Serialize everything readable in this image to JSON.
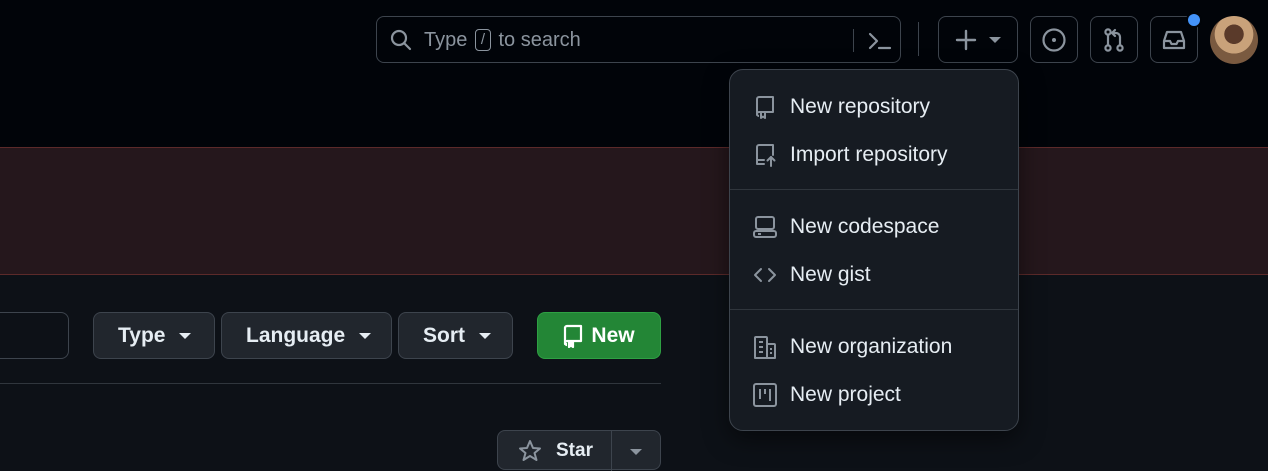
{
  "header": {
    "search_prefix": "Type",
    "search_key": "/",
    "search_suffix": "to search"
  },
  "filters": [
    {
      "label": "Type"
    },
    {
      "label": "Language"
    },
    {
      "label": "Sort"
    }
  ],
  "new_button": {
    "label": "New"
  },
  "star_button": {
    "label": "Star"
  },
  "create_menu": {
    "items": [
      {
        "label": "New repository",
        "icon": "repo-icon"
      },
      {
        "label": "Import repository",
        "icon": "repo-push-icon"
      },
      {
        "label": "New codespace",
        "icon": "codespaces-icon"
      },
      {
        "label": "New gist",
        "icon": "code-icon"
      },
      {
        "label": "New organization",
        "icon": "organization-icon"
      },
      {
        "label": "New project",
        "icon": "project-icon"
      }
    ]
  },
  "colors": {
    "accent_green": "#238636",
    "notification_blue": "#4493f8",
    "banner_bg": "#25171c"
  }
}
